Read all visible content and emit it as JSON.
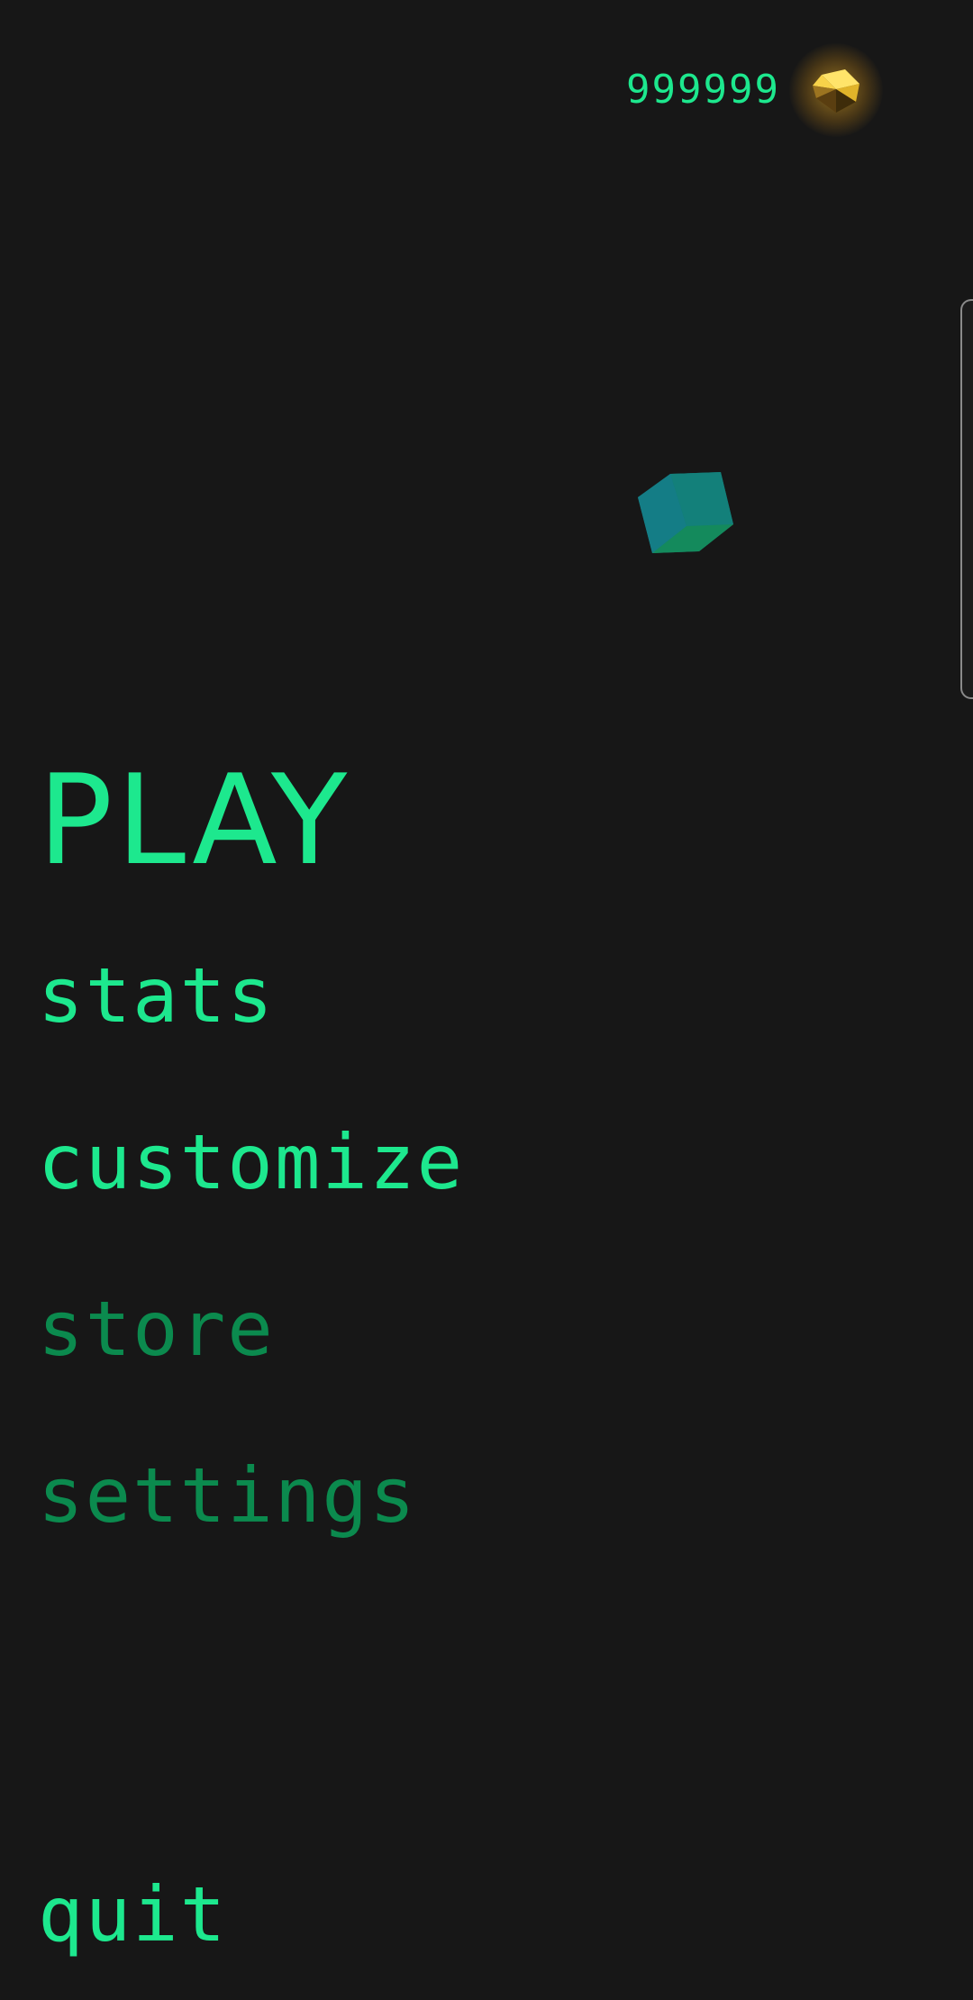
{
  "colors": {
    "background": "#171717",
    "accent_bright": "#1de88e",
    "accent_dim": "#0b8a4e",
    "gem_gold": "#f5c935",
    "cube_teal": "#137d79"
  },
  "header": {
    "currency_amount": "999999",
    "currency_icon": "gold-gem-icon"
  },
  "decor": {
    "cube_icon": "teal-cube-icon"
  },
  "menu": {
    "play": "PLAY",
    "stats": "stats",
    "customize": "customize",
    "store": "store",
    "settings": "settings",
    "quit": "quit"
  }
}
